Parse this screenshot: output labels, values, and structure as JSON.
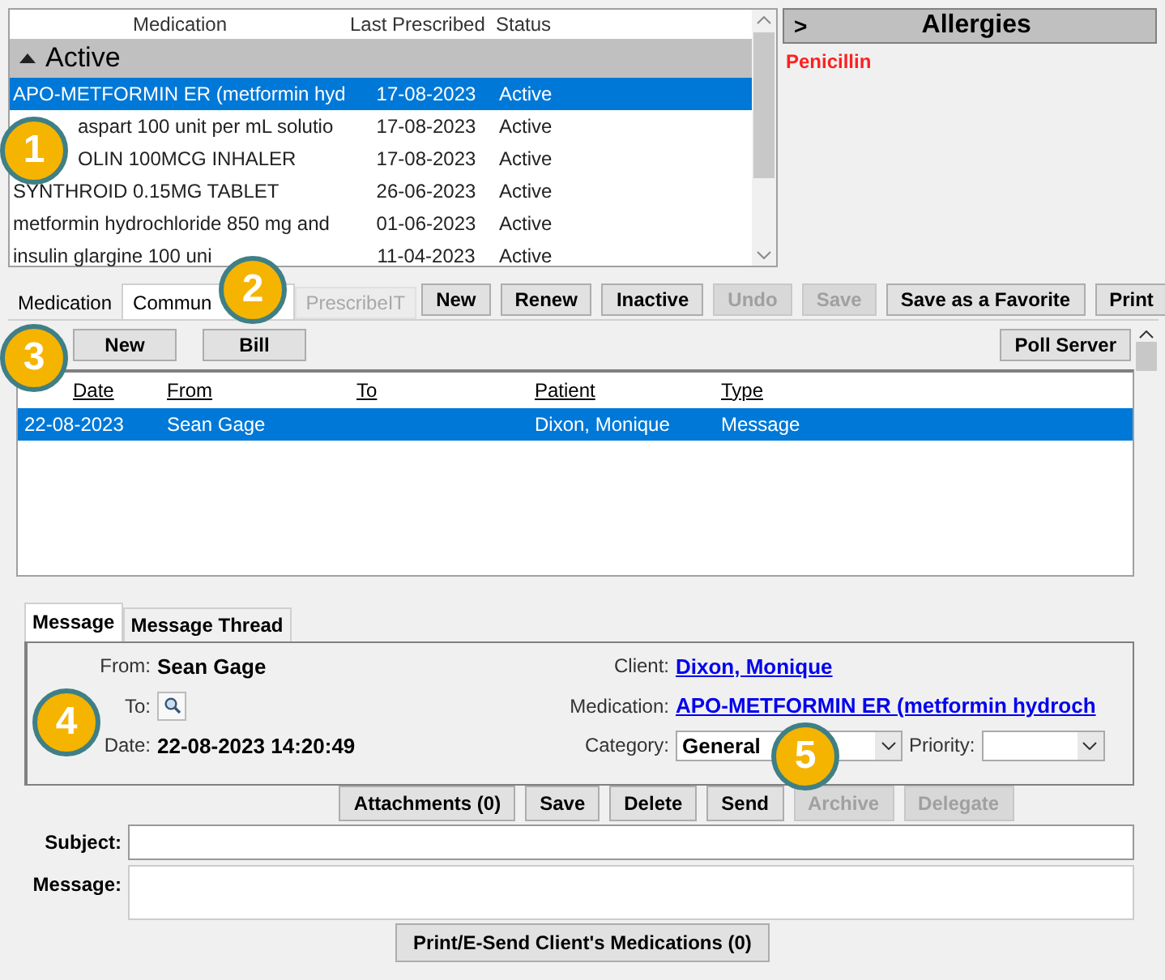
{
  "medications": {
    "columns": [
      "Medication",
      "Last Prescribed",
      "Status"
    ],
    "group": {
      "label": "Active",
      "expanded": true
    },
    "rows": [
      {
        "medication": "APO-METFORMIN ER (metformin hyd",
        "last_prescribed": "17-08-2023",
        "status": "Active",
        "selected": true
      },
      {
        "medication": "aspart 100 unit per mL solutio",
        "last_prescribed": "17-08-2023",
        "status": "Active",
        "selected": false
      },
      {
        "medication": "OLIN 100MCG INHALER",
        "last_prescribed": "17-08-2023",
        "status": "Active",
        "selected": false
      },
      {
        "medication": "SYNTHROID 0.15MG TABLET",
        "last_prescribed": "26-06-2023",
        "status": "Active",
        "selected": false
      },
      {
        "medication": "metformin hydrochloride 850 mg and",
        "last_prescribed": "01-06-2023",
        "status": "Active",
        "selected": false
      },
      {
        "medication": "insulin glargine 100 uni",
        "last_prescribed": "11-04-2023",
        "status": "Active",
        "selected": false
      }
    ]
  },
  "allergies": {
    "toggle": ">",
    "title": "Allergies",
    "items": [
      "Penicillin"
    ]
  },
  "tabs": [
    {
      "label": "Medication",
      "selected": false,
      "disabled": false
    },
    {
      "label": "Commun",
      "selected": true,
      "disabled": false
    },
    {
      "label": "PrescribeIT",
      "selected": false,
      "disabled": true
    }
  ],
  "toolbar": [
    {
      "label": "New",
      "disabled": false
    },
    {
      "label": "Renew",
      "disabled": false
    },
    {
      "label": "Inactive",
      "disabled": false
    },
    {
      "label": "Undo",
      "disabled": true
    },
    {
      "label": "Save",
      "disabled": true
    },
    {
      "label": "Save as a Favorite",
      "disabled": false
    },
    {
      "label": "Print",
      "disabled": false
    }
  ],
  "communication": {
    "buttons": [
      "New",
      "Bill"
    ],
    "poll_button": "Poll Server",
    "columns": [
      "Date",
      "From",
      "To",
      "Patient",
      "Type"
    ],
    "rows": [
      {
        "date": "22-08-2023",
        "from": "Sean Gage",
        "patient": "Dixon, Monique",
        "type": "Message",
        "selected": true
      }
    ]
  },
  "message_tabs": [
    {
      "label": "Message",
      "selected": true
    },
    {
      "label": "Message Thread",
      "selected": false
    }
  ],
  "message": {
    "from_label": "From:",
    "from": "Sean Gage",
    "to_label": "To:",
    "date_label": "Date:",
    "date": "22-08-2023 14:20:49",
    "client_label": "Client:",
    "client": "Dixon, Monique",
    "medication_label": "Medication:",
    "medication": "APO-METFORMIN ER (metformin hydroch",
    "category_label": "Category:",
    "category": "General",
    "priority_label": "Priority:"
  },
  "message_actions": [
    {
      "label": "Attachments (0)",
      "disabled": false
    },
    {
      "label": "Save",
      "disabled": false
    },
    {
      "label": "Delete",
      "disabled": false
    },
    {
      "label": "Send",
      "disabled": false
    },
    {
      "label": "Archive",
      "disabled": true
    },
    {
      "label": "Delegate",
      "disabled": true
    }
  ],
  "subject_label": "Subject:",
  "message_label": "Message:",
  "footer_button": "Print/E-Send Client's Medications (0)",
  "callouts": [
    "1",
    "2",
    "3",
    "4",
    "5"
  ]
}
